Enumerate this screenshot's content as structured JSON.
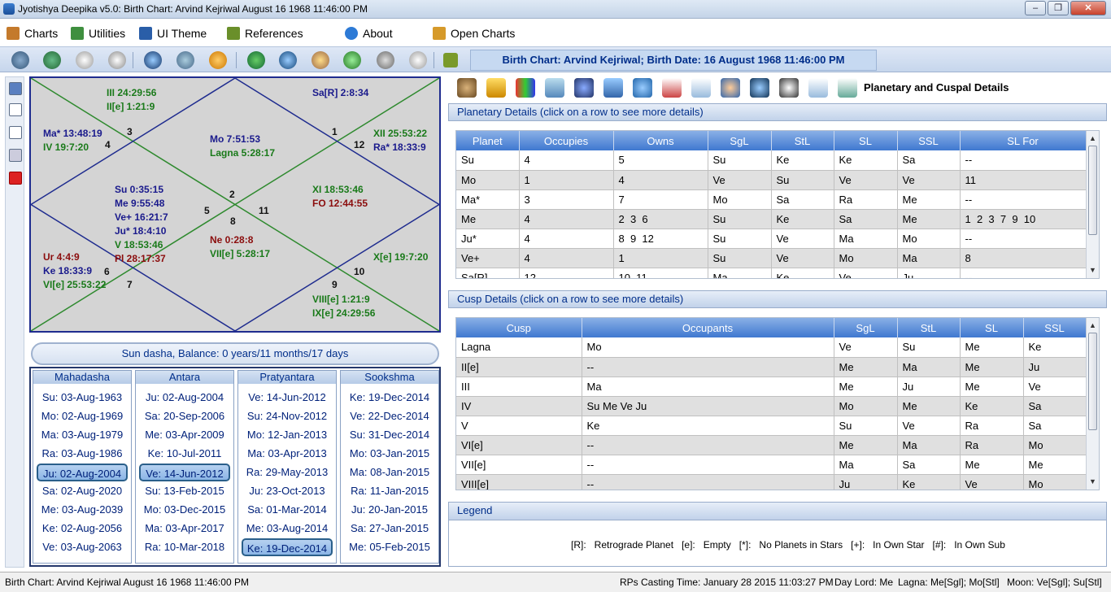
{
  "window": {
    "title": "Jyotishya Deepika v5.0:  Birth Chart: Arvind Kejriwal August 16 1968 11:46:00 PM"
  },
  "menu": [
    {
      "label": "Charts",
      "icon": "house-icon"
    },
    {
      "label": "Utilities",
      "icon": "gears-icon"
    },
    {
      "label": "UI Theme",
      "icon": "monitor-icon"
    },
    {
      "label": "References",
      "icon": "book-icon"
    },
    {
      "label": "About",
      "icon": "info-icon"
    },
    {
      "label": "Open Charts",
      "icon": "open-charts-icon"
    }
  ],
  "header": {
    "chart_title": "Birth Chart: Arvind Kejriwal; Birth Date: 16 August 1968 11:46:00 PM"
  },
  "chart": {
    "labels": [
      {
        "text": "III 24:29:56",
        "color": "gr"
      },
      {
        "text": "II[e] 1:21:9",
        "color": "gr"
      },
      {
        "text": "Sa[R] 2:8:34",
        "color": "nv"
      },
      {
        "text": "Ma* 13:48:19",
        "color": "nv"
      },
      {
        "text": "IV 19:7:20",
        "color": "gr"
      },
      {
        "text": "Mo 7:51:53",
        "color": "nv"
      },
      {
        "text": "Lagna 5:28:17",
        "color": "gr"
      },
      {
        "text": "XII 25:53:22",
        "color": "gr"
      },
      {
        "text": "Ra* 18:33:9",
        "color": "nv"
      },
      {
        "text": "Su 0:35:15",
        "color": "nv"
      },
      {
        "text": "Me 9:55:48",
        "color": "nv"
      },
      {
        "text": "Ve+ 16:21:7",
        "color": "nv"
      },
      {
        "text": "Ju* 18:4:10",
        "color": "nv"
      },
      {
        "text": "V 18:53:46",
        "color": "gr"
      },
      {
        "text": "Pl 28:17:37",
        "color": "rd"
      },
      {
        "text": "XI 18:53:46",
        "color": "gr"
      },
      {
        "text": "FO 12:44:55",
        "color": "rd"
      },
      {
        "text": "Ne 0:28:8",
        "color": "rd"
      },
      {
        "text": "VII[e] 5:28:17",
        "color": "gr"
      },
      {
        "text": "Ur 4:4:9",
        "color": "rd"
      },
      {
        "text": "Ke 18:33:9",
        "color": "nv"
      },
      {
        "text": "VI[e] 25:53:22",
        "color": "gr"
      },
      {
        "text": "X[e] 19:7:20",
        "color": "gr"
      },
      {
        "text": "VIII[e] 1:21:9",
        "color": "gr"
      },
      {
        "text": "IX[e] 24:29:56",
        "color": "gr"
      }
    ],
    "house_numbers": [
      "3",
      "4",
      "1",
      "12",
      "2",
      "5",
      "8",
      "11",
      "6",
      "7",
      "9",
      "10"
    ]
  },
  "dasha": {
    "balance": "Sun dasha, Balance: 0 years/11 months/17 days",
    "columns": [
      {
        "title": "Mahadasha",
        "items": [
          "Su: 03-Aug-1963",
          "Mo: 02-Aug-1969",
          "Ma: 03-Aug-1979",
          "Ra: 03-Aug-1986",
          "Ju: 02-Aug-2004",
          "Sa: 02-Aug-2020",
          "Me: 03-Aug-2039",
          "Ke: 02-Aug-2056",
          "Ve: 03-Aug-2063"
        ],
        "selected": 4
      },
      {
        "title": "Antara",
        "items": [
          "Ju: 02-Aug-2004",
          "Sa: 20-Sep-2006",
          "Me: 03-Apr-2009",
          "Ke: 10-Jul-2011",
          "Ve: 14-Jun-2012",
          "Su: 13-Feb-2015",
          "Mo: 03-Dec-2015",
          "Ma: 03-Apr-2017",
          "Ra: 10-Mar-2018"
        ],
        "selected": 4
      },
      {
        "title": "Pratyantara",
        "items": [
          "Ve: 14-Jun-2012",
          "Su: 24-Nov-2012",
          "Mo: 12-Jan-2013",
          "Ma: 03-Apr-2013",
          "Ra: 29-May-2013",
          "Ju: 23-Oct-2013",
          "Sa: 01-Mar-2014",
          "Me: 03-Aug-2014",
          "Ke: 19-Dec-2014"
        ],
        "selected": 8
      },
      {
        "title": "Sookshma",
        "items": [
          "Ke: 19-Dec-2014",
          "Ve: 22-Dec-2014",
          "Su: 31-Dec-2014",
          "Mo: 03-Jan-2015",
          "Ma: 08-Jan-2015",
          "Ra: 11-Jan-2015",
          "Ju: 20-Jan-2015",
          "Sa: 27-Jan-2015",
          "Me: 05-Feb-2015"
        ],
        "selected": -1
      }
    ]
  },
  "right": {
    "title": "Planetary and Cuspal Details",
    "planetary": {
      "heading": "Planetary Details (click on a row to see more details)",
      "columns": [
        "Planet",
        "Occupies",
        "Owns",
        "SgL",
        "StL",
        "SL",
        "SSL",
        "SL For"
      ],
      "rows": [
        [
          "Su",
          "4",
          "5",
          "Su",
          "Ke",
          "Ke",
          "Sa",
          "--"
        ],
        [
          "Mo",
          "1",
          "4",
          "Ve",
          "Su",
          "Ve",
          "Ve",
          "11"
        ],
        [
          "Ma*",
          "3",
          "7",
          "Mo",
          "Sa",
          "Ra",
          "Me",
          "--"
        ],
        [
          "Me",
          "4",
          "2  3  6",
          "Su",
          "Ke",
          "Sa",
          "Me",
          "1  2  3  7  9  10"
        ],
        [
          "Ju*",
          "4",
          "8  9  12",
          "Su",
          "Ve",
          "Ma",
          "Mo",
          "--"
        ],
        [
          "Ve+",
          "4",
          "1",
          "Su",
          "Ve",
          "Mo",
          "Ma",
          "8"
        ],
        [
          "Sa[R]",
          "12",
          "10  11",
          "Ma",
          "Ke",
          "Ve",
          "Ju",
          "--"
        ]
      ]
    },
    "cusp": {
      "heading": "Cusp Details (click on a row to see more details)",
      "columns": [
        "Cusp",
        "Occupants",
        "SgL",
        "StL",
        "SL",
        "SSL"
      ],
      "rows": [
        [
          "Lagna",
          "Mo",
          "Ve",
          "Su",
          "Me",
          "Ke"
        ],
        [
          "II[e]",
          "--",
          "Me",
          "Ma",
          "Me",
          "Ju"
        ],
        [
          "III",
          "Ma",
          "Me",
          "Ju",
          "Me",
          "Ve"
        ],
        [
          "IV",
          "Su Me Ve Ju",
          "Mo",
          "Me",
          "Ke",
          "Sa"
        ],
        [
          "V",
          "Ke",
          "Su",
          "Ve",
          "Ra",
          "Sa"
        ],
        [
          "VI[e]",
          "--",
          "Me",
          "Ma",
          "Ra",
          "Mo"
        ],
        [
          "VII[e]",
          "--",
          "Ma",
          "Sa",
          "Me",
          "Me"
        ],
        [
          "VIII[e]",
          "--",
          "Ju",
          "Ke",
          "Ve",
          "Mo"
        ]
      ]
    },
    "legend": {
      "heading": "Legend",
      "text": "[R]:   Retrograde Planet   [e]:   Empty   [*]:   No Planets in Stars   [+]:   In Own Star   [#]:   In Own Sub"
    }
  },
  "status": {
    "left": "Birth Chart: Arvind Kejriwal August 16 1968 11:46:00 PM",
    "rps": "RPs Casting Time: January 28 2015 11:03:27 PM",
    "daylord": "Day Lord: Me",
    "lagna": "Lagna: Me[Sgl]; Mo[Stl]",
    "moon": "Moon: Ve[Sgl]; Su[Stl]"
  },
  "colors": {
    "accent": "#3f78d0",
    "chart_line_blue": "#1f2c8f",
    "chart_line_green": "#2f8a2f"
  }
}
